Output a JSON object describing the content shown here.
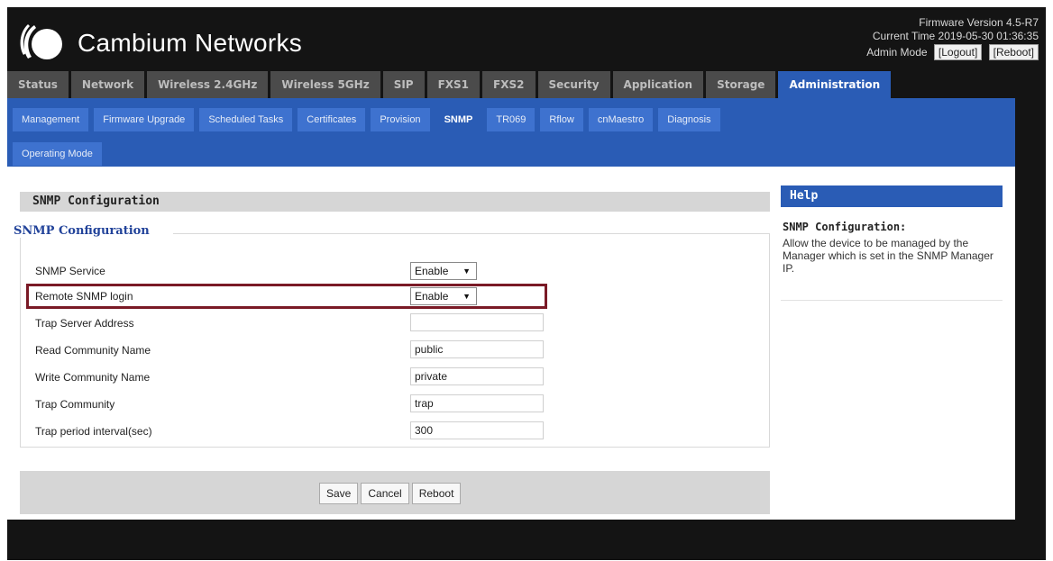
{
  "brand": {
    "name": "Cambium Networks"
  },
  "header": {
    "firmware": "Firmware Version 4.5-R7",
    "time": "Current Time 2019-05-30 01:36:35",
    "mode": "Admin Mode",
    "logout": "[Logout]",
    "reboot": "[Reboot]"
  },
  "main_tabs": [
    {
      "label": "Status"
    },
    {
      "label": "Network"
    },
    {
      "label": "Wireless 2.4GHz"
    },
    {
      "label": "Wireless 5GHz"
    },
    {
      "label": "SIP"
    },
    {
      "label": "FXS1"
    },
    {
      "label": "FXS2"
    },
    {
      "label": "Security"
    },
    {
      "label": "Application"
    },
    {
      "label": "Storage"
    },
    {
      "label": "Administration",
      "active": true
    }
  ],
  "sub_tabs": [
    {
      "label": "Management"
    },
    {
      "label": "Firmware Upgrade"
    },
    {
      "label": "Scheduled Tasks"
    },
    {
      "label": "Certificates"
    },
    {
      "label": "Provision"
    },
    {
      "label": "SNMP",
      "active": true
    },
    {
      "label": "TR069"
    },
    {
      "label": "Rflow"
    },
    {
      "label": "cnMaestro"
    },
    {
      "label": "Diagnosis"
    },
    {
      "label": "Operating Mode"
    }
  ],
  "section": {
    "title": "SNMP Configuration",
    "legend": "SNMP Configuration"
  },
  "form": [
    {
      "label": "SNMP Service",
      "type": "select",
      "value": "Enable"
    },
    {
      "label": "Remote SNMP login",
      "type": "select",
      "value": "Enable",
      "highlighted": true
    },
    {
      "label": "Trap Server Address",
      "type": "text",
      "value": ""
    },
    {
      "label": "Read Community Name",
      "type": "text",
      "value": "public"
    },
    {
      "label": "Write Community Name",
      "type": "text",
      "value": "private"
    },
    {
      "label": "Trap Community",
      "type": "text",
      "value": "trap"
    },
    {
      "label": "Trap period interval(sec)",
      "type": "text",
      "value": "300"
    }
  ],
  "buttons": {
    "save": "Save",
    "cancel": "Cancel",
    "reboot": "Reboot"
  },
  "help": {
    "heading": "Help",
    "title": "SNMP Configuration:",
    "text": "Allow the device to be managed by the Manager which is set in the SNMP Manager IP."
  },
  "colors": {
    "accent": "#2a5cb5",
    "highlight_border": "#7a1a26",
    "header_bg": "#141414"
  }
}
